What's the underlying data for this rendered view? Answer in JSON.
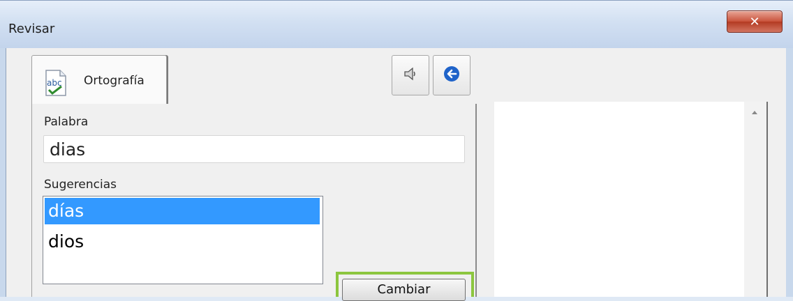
{
  "window": {
    "title": "Revisar",
    "close_glyph": "✕"
  },
  "tabs": [
    {
      "label": "Ortografía",
      "icon": "abc-spellcheck-icon"
    }
  ],
  "toolbar": {
    "speaker_icon": "speaker-icon",
    "back_icon": "back-arrow-icon"
  },
  "word": {
    "label": "Palabra",
    "value": "dias"
  },
  "suggestions": {
    "label": "Sugerencias",
    "items": [
      "días",
      "dios"
    ],
    "selected_index": 0
  },
  "actions": {
    "change_label": "Cambiar"
  },
  "colors": {
    "selection": "#3399ff",
    "highlight": "#8cc63f",
    "close_button": "#c9523a"
  }
}
